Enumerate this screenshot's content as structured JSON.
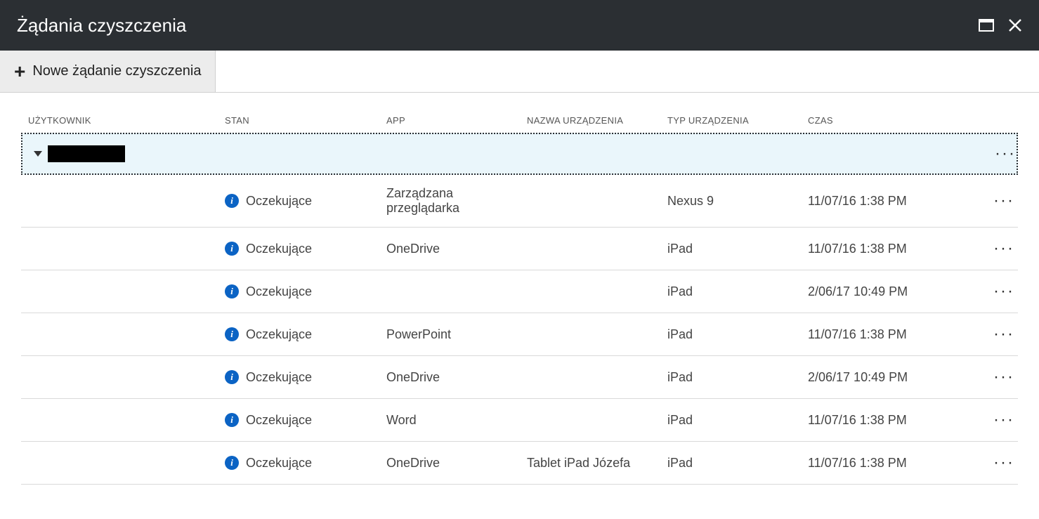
{
  "header": {
    "title": "Żądania czyszczenia"
  },
  "toolbar": {
    "new_request_label": "Nowe żądanie czyszczenia"
  },
  "columns": {
    "user": "UŻYTKOWNIK",
    "status": "STAN",
    "app": "APP",
    "device_name": "NAZWA URZĄDZENIA",
    "device_type": "TYP URZĄDZENIA",
    "time": "CZAS"
  },
  "rows": [
    {
      "status": "Oczekujące",
      "app": "Zarządzana przeglądarka",
      "device_name": "",
      "device_type": "Nexus 9",
      "time": "11/07/16 1:38 PM"
    },
    {
      "status": "Oczekujące",
      "app": "OneDrive",
      "device_name": "",
      "device_type": "iPad",
      "time": "11/07/16 1:38 PM"
    },
    {
      "status": "Oczekujące",
      "app": "",
      "device_name": "",
      "device_type": "iPad",
      "time": "2/06/17 10:49 PM"
    },
    {
      "status": "Oczekujące",
      "app": "PowerPoint",
      "device_name": "",
      "device_type": "iPad",
      "time": "11/07/16 1:38 PM"
    },
    {
      "status": "Oczekujące",
      "app": "OneDrive",
      "device_name": "",
      "device_type": "iPad",
      "time": "2/06/17 10:49 PM"
    },
    {
      "status": "Oczekujące",
      "app": "Word",
      "device_name": "",
      "device_type": "iPad",
      "time": "11/07/16 1:38 PM"
    },
    {
      "status": "Oczekujące",
      "app": "OneDrive",
      "device_name": "Tablet iPad Józefa",
      "device_type": "iPad",
      "time": "11/07/16 1:38 PM"
    }
  ]
}
